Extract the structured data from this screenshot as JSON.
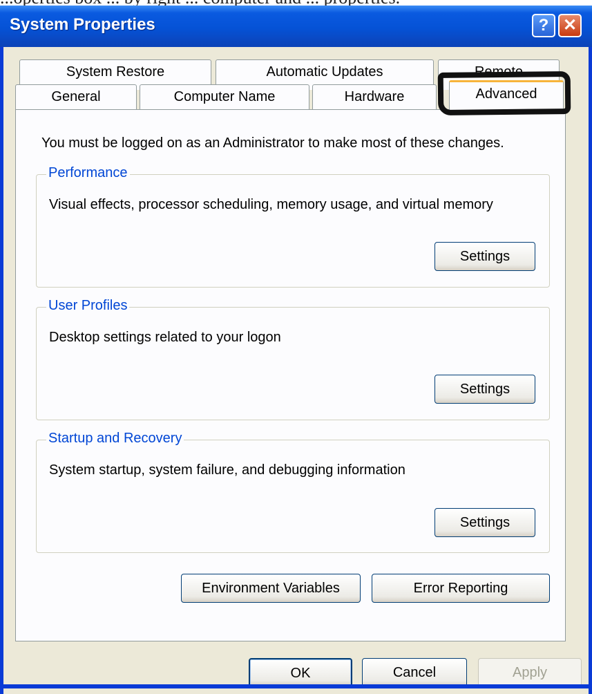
{
  "caption_fragment": "...operties box ... by right ... computer and ... properties.",
  "window": {
    "title": "System Properties",
    "help_label": "?",
    "close_label": "✕"
  },
  "tabs_row1": [
    {
      "label": "System Restore"
    },
    {
      "label": "Automatic Updates"
    },
    {
      "label": "Remote"
    }
  ],
  "tabs_row2": [
    {
      "label": "General"
    },
    {
      "label": "Computer Name"
    },
    {
      "label": "Hardware"
    },
    {
      "label": "Advanced",
      "selected": true
    }
  ],
  "notice": "You must be logged on as an Administrator to make most of these changes.",
  "groups": {
    "performance": {
      "title": "Performance",
      "description": "Visual effects, processor scheduling, memory usage, and virtual memory",
      "button": "Settings"
    },
    "user_profiles": {
      "title": "User Profiles",
      "description": "Desktop settings related to your logon",
      "button": "Settings"
    },
    "startup_recovery": {
      "title": "Startup and Recovery",
      "description": "System startup, system failure, and debugging information",
      "button": "Settings"
    }
  },
  "actions": {
    "env_vars": "Environment Variables",
    "error_reporting": "Error Reporting"
  },
  "dialog_buttons": {
    "ok": "OK",
    "cancel": "Cancel",
    "apply": "Apply"
  },
  "colors": {
    "titlebar": "#0552d6",
    "face": "#ece9d8",
    "group_label": "#0046d5",
    "selected_tab_accent": "#f7b43a"
  }
}
